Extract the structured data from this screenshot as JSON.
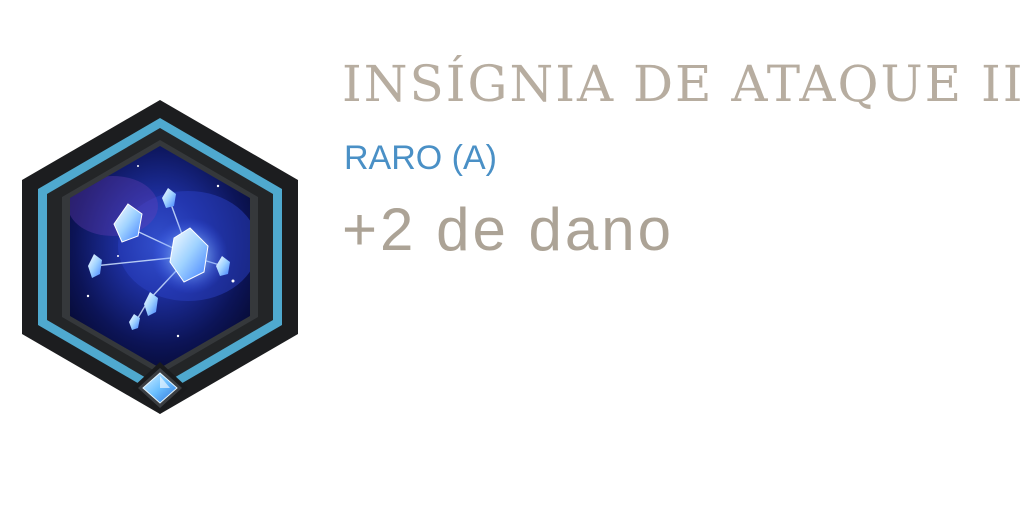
{
  "item": {
    "name": "INSÍGNIA DE ATAQUE II",
    "rarity": "RARO (A)",
    "effect": "+2 de dano",
    "icon": "attack-insignia-constellation-icon"
  },
  "colors": {
    "name": "#b7ada0",
    "rarity": "#4a90c6",
    "effect": "#aca396",
    "frame_outer": "#1c1d1f",
    "frame_accent": "#4fa9cf",
    "gem": "#7cc8ff"
  }
}
